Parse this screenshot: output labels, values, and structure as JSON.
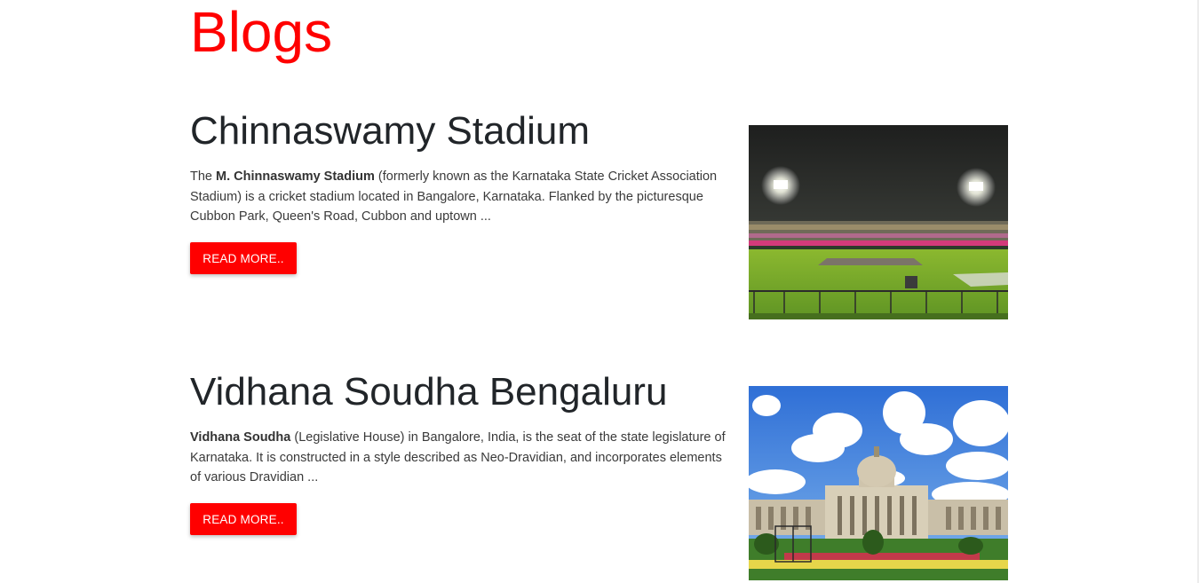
{
  "page": {
    "heading": "Blogs"
  },
  "posts": [
    {
      "title": "Chinnaswamy Stadium",
      "excerpt_lead": "The ",
      "excerpt_bold": "M. Chinnaswamy Stadium",
      "excerpt_rest": " (formerly known as the Karnataka State Cricket Association Stadium) is a cricket stadium located in Bangalore, Karnataka. Flanked by the picturesque Cubbon Park, Queen's Road, Cubbon and uptown ...",
      "button_label": "READ MORE..",
      "image": "stadium-photo"
    },
    {
      "title": "Vidhana Soudha Bengaluru",
      "excerpt_lead": "",
      "excerpt_bold": "Vidhana Soudha",
      "excerpt_rest": " (Legislative House) in Bangalore, India, is the seat of the state legislature of Karnataka. It is constructed in a style described as Neo-Dravidian, and incorporates elements of various Dravidian ...",
      "button_label": "READ MORE..",
      "image": "vidhana-soudha-photo"
    }
  ],
  "colors": {
    "accent": "#ff0000",
    "text": "#212529"
  }
}
